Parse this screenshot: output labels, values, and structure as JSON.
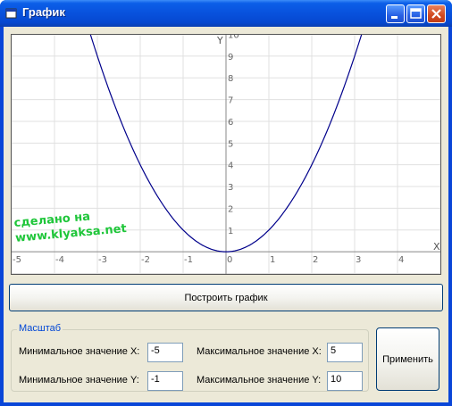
{
  "window": {
    "title": "График",
    "title_color": "#ffffff",
    "titlebar_color": "#0851dd"
  },
  "plot": {
    "x_axis_label": "X",
    "y_axis_label": "Y",
    "watermark": [
      "сделано на",
      "www.klyaksa.net"
    ],
    "curve_color": "#00008b",
    "grid_color": "#e0e0e0"
  },
  "chart_data": {
    "type": "line",
    "function": "y = x^2",
    "xlim": [
      -5,
      5
    ],
    "ylim": [
      -1,
      10
    ],
    "x_ticks": [
      -5,
      -4,
      -3,
      -2,
      -1,
      0,
      1,
      2,
      3,
      4
    ],
    "y_ticks": [
      1,
      2,
      3,
      4,
      5,
      6,
      7,
      8,
      9,
      10
    ],
    "x_tick_labels": [
      "-5",
      "-4",
      "-3",
      "-2",
      "-1",
      "0",
      "1",
      "2",
      "3",
      "4"
    ],
    "y_tick_labels": [
      "1",
      "2",
      "3",
      "4",
      "5",
      "6",
      "7",
      "8",
      "9",
      "10"
    ],
    "xlabel": "X",
    "ylabel": "Y",
    "grid": true,
    "series": [
      {
        "x": [
          -5,
          -4.5,
          -4,
          -3.5,
          -3,
          -2.5,
          -2,
          -1.5,
          -1,
          -0.5,
          0,
          0.5,
          1,
          1.5,
          2,
          2.5,
          3,
          3.5,
          4,
          4.5,
          5
        ],
        "y": [
          25,
          20.25,
          16,
          12.25,
          9,
          6.25,
          4,
          2.25,
          1,
          0.25,
          0,
          0.25,
          1,
          2.25,
          4,
          6.25,
          9,
          12.25,
          16,
          20.25,
          25
        ]
      }
    ]
  },
  "buttons": {
    "plot": "Построить график",
    "apply": "Применить"
  },
  "scale": {
    "title": "Масштаб",
    "min_x_label": "Минимальное значение X:",
    "min_x_value": "-5",
    "max_x_label": "Максимальное значение X:",
    "max_x_value": "5",
    "min_y_label": "Минимальное значение Y:",
    "min_y_value": "-1",
    "max_y_label": "Максимальное значение Y:",
    "max_y_value": "10"
  }
}
